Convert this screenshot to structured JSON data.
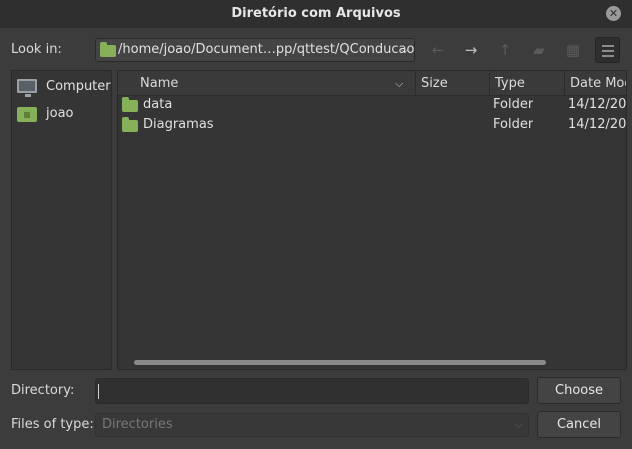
{
  "window": {
    "title": "Diretório com Arquivos"
  },
  "lookin": {
    "label": "Look in:",
    "path": "/home/joao/Document…pp/qttest/QConducao"
  },
  "sidebar": {
    "items": [
      {
        "label": "Computer",
        "icon": "computer-icon"
      },
      {
        "label": "joao",
        "icon": "home-folder-icon"
      }
    ]
  },
  "filelist": {
    "columns": [
      "Name",
      "Size",
      "Type",
      "Date Mod"
    ],
    "rows": [
      {
        "name": "data",
        "size": "",
        "type": "Folder",
        "date": "14/12/20"
      },
      {
        "name": "Diagramas",
        "size": "",
        "type": "Folder",
        "date": "14/12/20"
      }
    ]
  },
  "directory": {
    "label": "Directory:",
    "value": ""
  },
  "filetype": {
    "label": "Files of type:",
    "value": "Directories"
  },
  "buttons": {
    "choose": "Choose",
    "cancel": "Cancel"
  },
  "colors": {
    "folder": "#87b158",
    "background": "#3c3c3c",
    "panel": "#353535"
  }
}
